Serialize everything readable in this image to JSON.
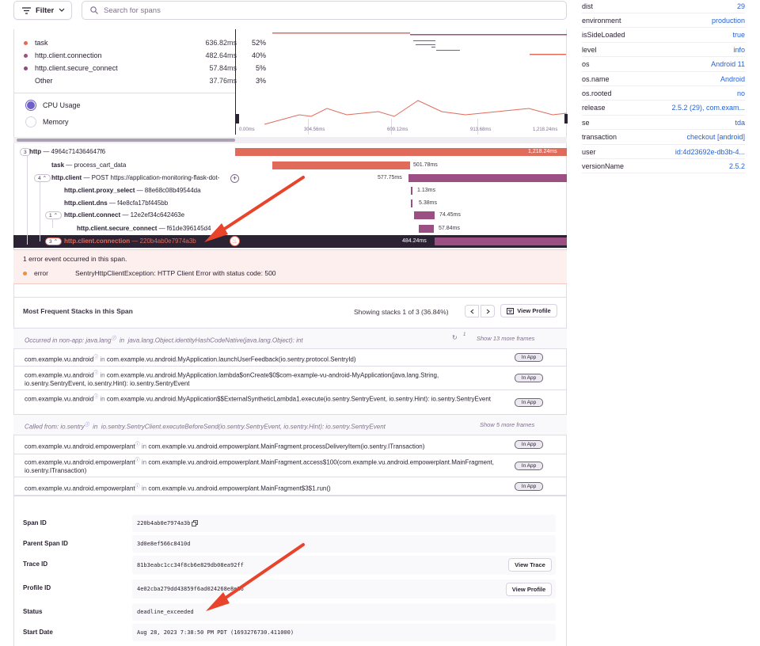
{
  "toolbar": {
    "filter_label": "Filter",
    "search_placeholder": "Search for spans"
  },
  "legend": [
    {
      "name": "task",
      "duration": "636.82ms",
      "pct": "52%",
      "color": "#e06b5b"
    },
    {
      "name": "http.client.connection",
      "duration": "482.64ms",
      "pct": "40%",
      "color": "#9b4f82"
    },
    {
      "name": "http.client.secure_connect",
      "duration": "57.84ms",
      "pct": "5%",
      "color": "#8a4a7e"
    },
    {
      "name": "Other",
      "duration": "37.76ms",
      "pct": "3%",
      "color": ""
    }
  ],
  "chart_toggles": {
    "cpu": "CPU Usage",
    "memory": "Memory"
  },
  "ticks": [
    "0.00ms",
    "304.56ms",
    "609.12ms",
    "913.68ms",
    "1,218.24ms"
  ],
  "tree": [
    {
      "badge": "3",
      "op": "http",
      "desc": " — 4964c714364647f6",
      "bar_label": "1,218.24ms"
    },
    {
      "badge": "",
      "op": "task",
      "desc": " — process_cart_data",
      "bar_label": "501.78ms"
    },
    {
      "badge": "4",
      "op": "http.client",
      "desc": " — POST https://application-monitoring-flask-dot-",
      "bar_label": "577.75ms"
    },
    {
      "badge": "",
      "op": "http.client.proxy_select",
      "desc": " — 88e68c08b49544da",
      "bar_label": "1.13ms"
    },
    {
      "badge": "",
      "op": "http.client.dns",
      "desc": " — f4e8cfa17bf445bb",
      "bar_label": "5.38ms"
    },
    {
      "badge": "1",
      "op": "http.client.connect",
      "desc": " — 12e2ef34c642463e",
      "bar_label": "74.45ms"
    },
    {
      "badge": "",
      "op": "http.client.secure_connect",
      "desc": " — f61de396145d4",
      "bar_label": "57.84ms"
    },
    {
      "badge": "3",
      "op": "http.client.connection",
      "desc": " — 220b4ab0e7974a3b",
      "bar_label": "484.24ms"
    }
  ],
  "error": {
    "summary": "1 error event occurred in this span.",
    "level": "error",
    "message": "SentryHttpClientException: HTTP Client Error with status code: 500"
  },
  "stacks": {
    "title": "Most Frequent Stacks in this Span",
    "showing": "Showing stacks 1 of 3 (36.84%)",
    "view_profile": "View Profile",
    "in_app": "In App",
    "in_word": "in",
    "sys1": {
      "prefix": "Occurred in non-app: java.lang",
      "fn": "java.lang.Object.identityHashCodeNative(java.lang.Object): int",
      "count": "1",
      "more": "Show 13 more frames"
    },
    "frames1": [
      {
        "pkg": "com.example.vu.android",
        "fn": "com.example.vu.android.MyApplication.launchUserFeedback(io.sentry.protocol.SentryId)"
      },
      {
        "pkg": "com.example.vu.android",
        "fn": "com.example.vu.android.MyApplication.lambda$onCreate$0$com-example-vu-android-MyApplication(java.lang.String, io.sentry.SentryEvent, io.sentry.Hint): io.sentry.SentryEvent"
      },
      {
        "pkg": "com.example.vu.android",
        "fn": "com.example.vu.android.MyApplication$$ExternalSyntheticLambda1.execute(io.sentry.SentryEvent, io.sentry.Hint): io.sentry.SentryEvent"
      }
    ],
    "sys2": {
      "prefix": "Called from: io.sentry",
      "fn": "io.sentry.SentryClient.executeBeforeSend(io.sentry.SentryEvent, io.sentry.Hint): io.sentry.SentryEvent",
      "more": "Show 5 more frames"
    },
    "frames2": [
      {
        "pkg": "com.example.vu.android.empowerplant",
        "fn": "com.example.vu.android.empowerplant.MainFragment.processDeliveryItem(io.sentry.ITransaction)"
      },
      {
        "pkg": "com.example.vu.android.empowerplant",
        "fn": "com.example.vu.android.empowerplant.MainFragment.access$100(com.example.vu.android.empowerplant.MainFragment, io.sentry.ITransaction)"
      },
      {
        "pkg": "com.example.vu.android.empowerplant",
        "fn": "com.example.vu.android.empowerplant.MainFragment$3$1.run()"
      }
    ]
  },
  "details": {
    "span_id_label": "Span ID",
    "span_id": "220b4ab0e7974a3b",
    "parent_label": "Parent Span ID",
    "parent": "3d0e8ef566c8410d",
    "trace_label": "Trace ID",
    "trace": "81b3eabc1cc34f8cb6e829db08ea92ff",
    "view_trace": "View Trace",
    "profile_label": "Profile ID",
    "profile": "4e02cba279dd43859f6ad024268e8e26",
    "view_profile": "View Profile",
    "status_label": "Status",
    "status": "deadline_exceeded",
    "start_label": "Start Date",
    "start": "Aug 28, 2023 7:38:50 PM PDT (1693276730.411000)"
  },
  "tags": [
    {
      "k": "dist",
      "v": "29"
    },
    {
      "k": "environment",
      "v": "production"
    },
    {
      "k": "isSideLoaded",
      "v": "true"
    },
    {
      "k": "level",
      "v": "info"
    },
    {
      "k": "os",
      "v": "Android 11"
    },
    {
      "k": "os.name",
      "v": "Android"
    },
    {
      "k": "os.rooted",
      "v": "no"
    },
    {
      "k": "release",
      "v": "2.5.2 (29), com.exam..."
    },
    {
      "k": "se",
      "v": "tda"
    },
    {
      "k": "transaction",
      "v": "checkout [android]"
    },
    {
      "k": "user",
      "v": "id:4d23692e-db3b-4..."
    },
    {
      "k": "versionName",
      "v": "2.5.2"
    }
  ]
}
